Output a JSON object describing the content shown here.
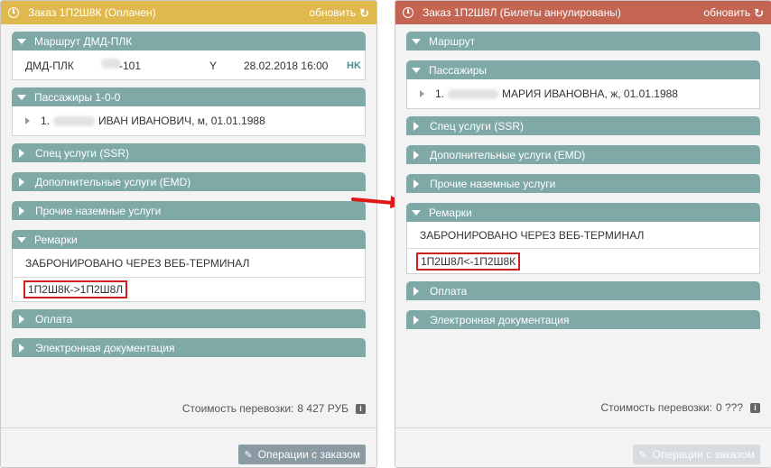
{
  "left": {
    "title": "Заказ 1П2Ш8К (Оплачен)",
    "refresh_label": "обновить",
    "sections": {
      "route": "Маршрут ДМД-ПЛК",
      "passengers": "Пассажиры 1-0-0",
      "ssr": "Спец услуги (SSR)",
      "emd": "Дополнительные услуги (EMD)",
      "ground": "Прочие наземные услуги",
      "remarks": "Ремарки",
      "payment": "Оплата",
      "edoc": "Электронная документация"
    },
    "route_row": {
      "route": "ДМД-ПЛК",
      "flight": "-101",
      "class": "Y",
      "datetime": "28.02.2018 16:00",
      "status": "HK"
    },
    "passenger_row": {
      "index": "1.",
      "name": "ИВАН ИВАНОВИЧ, м, 01.01.1988"
    },
    "remarks_rows": [
      "ЗАБРОНИРОВАНО ЧЕРЕЗ ВЕБ-ТЕРМИНАЛ",
      "1П2Ш8К->1П2Ш8Л"
    ],
    "cost_label": "Стоимость перевозки:",
    "cost_value": "8 427 РУБ",
    "ops_label": "Операции с заказом"
  },
  "right": {
    "title": "Заказ 1П2Ш8Л (Билеты аннулированы)",
    "refresh_label": "обновить",
    "sections": {
      "route": "Маршрут",
      "passengers": "Пассажиры",
      "ssr": "Спец услуги (SSR)",
      "emd": "Дополнительные услуги (EMD)",
      "ground": "Прочие наземные услуги",
      "remarks": "Ремарки",
      "payment": "Оплата",
      "edoc": "Электронная документация"
    },
    "passenger_row": {
      "index": "1.",
      "name": "МАРИЯ ИВАНОВНА, ж, 01.01.1988"
    },
    "remarks_rows": [
      "ЗАБРОНИРОВАНО ЧЕРЕЗ ВЕБ-ТЕРМИНАЛ",
      "1П2Ш8Л<-1П2Ш8К"
    ],
    "cost_label": "Стоимость перевозки:",
    "cost_value": "0 ???",
    "ops_label": "Операции с заказом"
  },
  "colors": {
    "paid": "#e0b94e",
    "cancelled": "#c36552",
    "section": "#7ea9a7",
    "highlight": "#cc1f1f"
  },
  "icons": [
    "clock-icon",
    "refresh-icon",
    "triangle-down-icon",
    "triangle-right-icon",
    "info-icon",
    "pencil-icon",
    "red-arrow-icon"
  ]
}
